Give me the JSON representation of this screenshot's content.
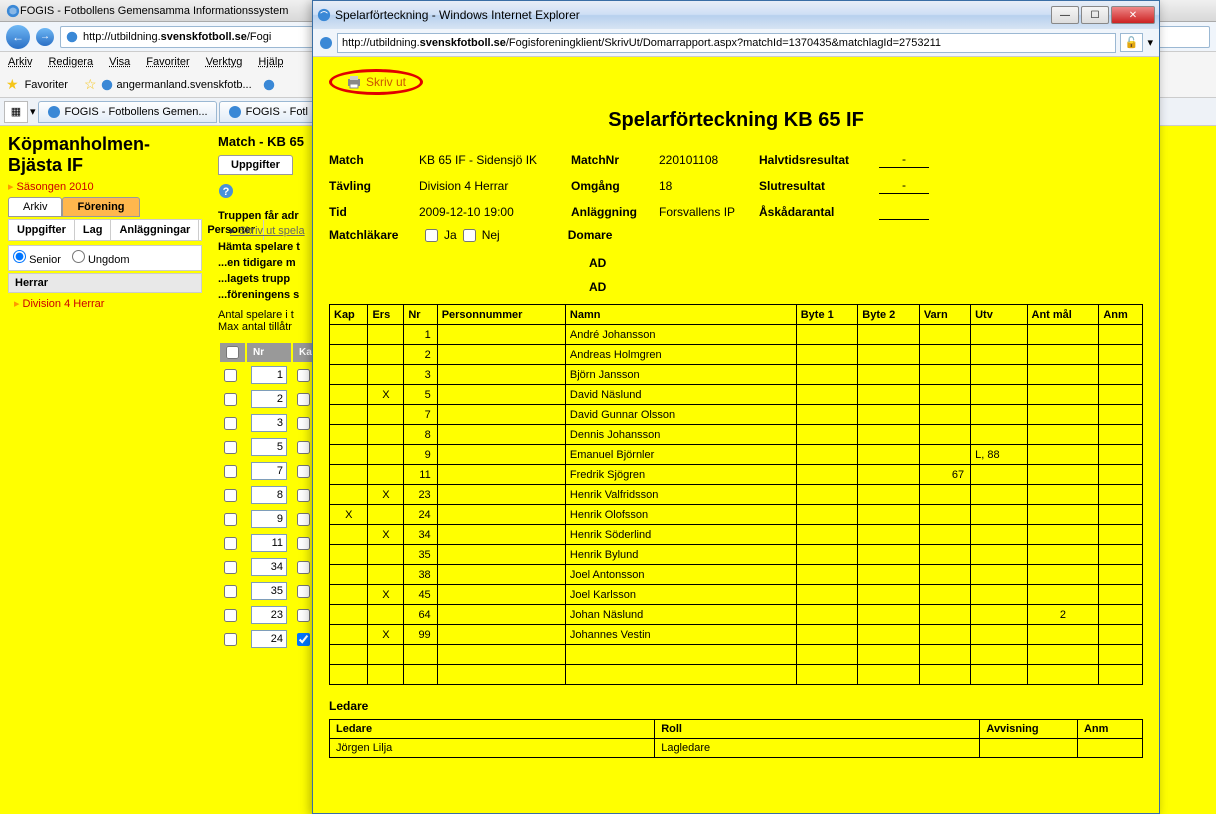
{
  "back": {
    "title": "FOGIS - Fotbollens Gemensamma Informationssystem",
    "url_prefix": "http://utbildning.",
    "url_host": "svenskfotboll.se",
    "url_path": "/Fogi",
    "menu": [
      "Arkiv",
      "Redigera",
      "Visa",
      "Favoriter",
      "Verktyg",
      "Hjälp"
    ],
    "fav_label": "Favoriter",
    "fav_link": "angermanland.svenskfotb...",
    "tabs": [
      "FOGIS - Fotbollens Gemen...",
      "FOGIS - Fotl"
    ],
    "club": "Köpmanholmen-Bjästa IF",
    "season": "Säsongen 2010",
    "sidetabs": {
      "archive": "Arkiv",
      "assoc": "Förening"
    },
    "subtabs": [
      "Uppgifter",
      "Lag",
      "Anläggningar",
      "Personer"
    ],
    "radio": {
      "senior": "Senior",
      "ungdom": "Ungdom"
    },
    "cat": "Herrar",
    "division": "Division 4 Herrar",
    "match_heading": "Match - KB 65",
    "uppgifter": "Uppgifter",
    "truppen": "Truppen får adr",
    "skrivut": "Skriv ut spela",
    "hamta": "Hämta spelare t",
    "tidigare": "...en tidigare m",
    "lagets": "...lagets trupp",
    "foreningens": "...föreningens s",
    "antal": "Antal spelare i t",
    "max": "Max antal tillåtr",
    "nrhead": {
      "chk": "",
      "nr": "Nr",
      "kap": "Kap"
    },
    "nrs": [
      "1",
      "2",
      "3",
      "5",
      "7",
      "8",
      "9",
      "11",
      "34",
      "35",
      "23",
      "24"
    ]
  },
  "popup": {
    "title": "Spelarförteckning - Windows Internet Explorer",
    "url_prefix": "http://utbildning.",
    "url_host": "svenskfotboll.se",
    "url_path": "/Fogisforeningklient/SkrivUt/Domarrapport.aspx?matchId=1370435&matchlagId=2753211",
    "print": "Skriv ut",
    "heading": "Spelarförteckning KB 65 IF",
    "info": {
      "match_lbl": "Match",
      "match_val": "KB 65 IF - Sidensjö IK",
      "tavling_lbl": "Tävling",
      "tavling_val": "Division 4 Herrar",
      "tid_lbl": "Tid",
      "tid_val": "2009-12-10 19:00",
      "matchnr_lbl": "MatchNr",
      "matchnr_val": "220101108",
      "omgang_lbl": "Omgång",
      "omgang_val": "18",
      "anl_lbl": "Anläggning",
      "anl_val": "Forsvallens IP",
      "halvtid_lbl": "Halvtidsresultat",
      "halvtid_val": "-",
      "slut_lbl": "Slutresultat",
      "slut_val": "-",
      "askadare_lbl": "Åskådarantal",
      "askadare_val": "",
      "lakare_lbl": "Matchläkare",
      "ja": "Ja",
      "nej": "Nej",
      "domare": "Domare",
      "ad": "AD"
    },
    "ptbl": {
      "headers": {
        "kap": "Kap",
        "ers": "Ers",
        "nr": "Nr",
        "pn": "Personnummer",
        "namn": "Namn",
        "b1": "Byte 1",
        "b2": "Byte 2",
        "varn": "Varn",
        "utv": "Utv",
        "mal": "Ant mål",
        "anm": "Anm"
      },
      "rows": [
        {
          "kap": "",
          "ers": "",
          "nr": "1",
          "pn": "",
          "namn": "André Johansson",
          "b1": "",
          "b2": "",
          "varn": "",
          "utv": "",
          "mal": "",
          "anm": ""
        },
        {
          "kap": "",
          "ers": "",
          "nr": "2",
          "pn": "",
          "namn": "Andreas Holmgren",
          "b1": "",
          "b2": "",
          "varn": "",
          "utv": "",
          "mal": "",
          "anm": ""
        },
        {
          "kap": "",
          "ers": "",
          "nr": "3",
          "pn": "",
          "namn": "Björn Jansson",
          "b1": "",
          "b2": "",
          "varn": "",
          "utv": "",
          "mal": "",
          "anm": ""
        },
        {
          "kap": "",
          "ers": "X",
          "nr": "5",
          "pn": "",
          "namn": "David Näslund",
          "b1": "",
          "b2": "",
          "varn": "",
          "utv": "",
          "mal": "",
          "anm": ""
        },
        {
          "kap": "",
          "ers": "",
          "nr": "7",
          "pn": "",
          "namn": "David Gunnar Olsson",
          "b1": "",
          "b2": "",
          "varn": "",
          "utv": "",
          "mal": "",
          "anm": ""
        },
        {
          "kap": "",
          "ers": "",
          "nr": "8",
          "pn": "",
          "namn": "Dennis Johansson",
          "b1": "",
          "b2": "",
          "varn": "",
          "utv": "",
          "mal": "",
          "anm": ""
        },
        {
          "kap": "",
          "ers": "",
          "nr": "9",
          "pn": "",
          "namn": "Emanuel Björnler",
          "b1": "",
          "b2": "",
          "varn": "",
          "utv": "L, 88",
          "mal": "",
          "anm": ""
        },
        {
          "kap": "",
          "ers": "",
          "nr": "11",
          "pn": "",
          "namn": "Fredrik Sjögren",
          "b1": "",
          "b2": "",
          "varn": "67",
          "utv": "",
          "mal": "",
          "anm": ""
        },
        {
          "kap": "",
          "ers": "X",
          "nr": "23",
          "pn": "",
          "namn": "Henrik Valfridsson",
          "b1": "",
          "b2": "",
          "varn": "",
          "utv": "",
          "mal": "",
          "anm": ""
        },
        {
          "kap": "X",
          "ers": "",
          "nr": "24",
          "pn": "",
          "namn": "Henrik Olofsson",
          "b1": "",
          "b2": "",
          "varn": "",
          "utv": "",
          "mal": "",
          "anm": ""
        },
        {
          "kap": "",
          "ers": "X",
          "nr": "34",
          "pn": "",
          "namn": "Henrik Söderlind",
          "b1": "",
          "b2": "",
          "varn": "",
          "utv": "",
          "mal": "",
          "anm": ""
        },
        {
          "kap": "",
          "ers": "",
          "nr": "35",
          "pn": "",
          "namn": "Henrik Bylund",
          "b1": "",
          "b2": "",
          "varn": "",
          "utv": "",
          "mal": "",
          "anm": ""
        },
        {
          "kap": "",
          "ers": "",
          "nr": "38",
          "pn": "",
          "namn": "Joel Antonsson",
          "b1": "",
          "b2": "",
          "varn": "",
          "utv": "",
          "mal": "",
          "anm": ""
        },
        {
          "kap": "",
          "ers": "X",
          "nr": "45",
          "pn": "",
          "namn": "Joel Karlsson",
          "b1": "",
          "b2": "",
          "varn": "",
          "utv": "",
          "mal": "",
          "anm": ""
        },
        {
          "kap": "",
          "ers": "",
          "nr": "64",
          "pn": "",
          "namn": "Johan Näslund",
          "b1": "",
          "b2": "",
          "varn": "",
          "utv": "",
          "mal": "2",
          "anm": ""
        },
        {
          "kap": "",
          "ers": "X",
          "nr": "99",
          "pn": "",
          "namn": "Johannes Vestin",
          "b1": "",
          "b2": "",
          "varn": "",
          "utv": "",
          "mal": "",
          "anm": ""
        },
        {
          "kap": "",
          "ers": "",
          "nr": "",
          "pn": "",
          "namn": "",
          "b1": "",
          "b2": "",
          "varn": "",
          "utv": "",
          "mal": "",
          "anm": ""
        },
        {
          "kap": "",
          "ers": "",
          "nr": "",
          "pn": "",
          "namn": "",
          "b1": "",
          "b2": "",
          "varn": "",
          "utv": "",
          "mal": "",
          "anm": ""
        }
      ]
    },
    "ledare_title": "Ledare",
    "ledare_headers": {
      "ledare": "Ledare",
      "roll": "Roll",
      "avv": "Avvisning",
      "anm": "Anm"
    },
    "ledare_rows": [
      {
        "ledare": "Jörgen Lilja",
        "roll": "Lagledare",
        "avv": "",
        "anm": ""
      }
    ]
  }
}
